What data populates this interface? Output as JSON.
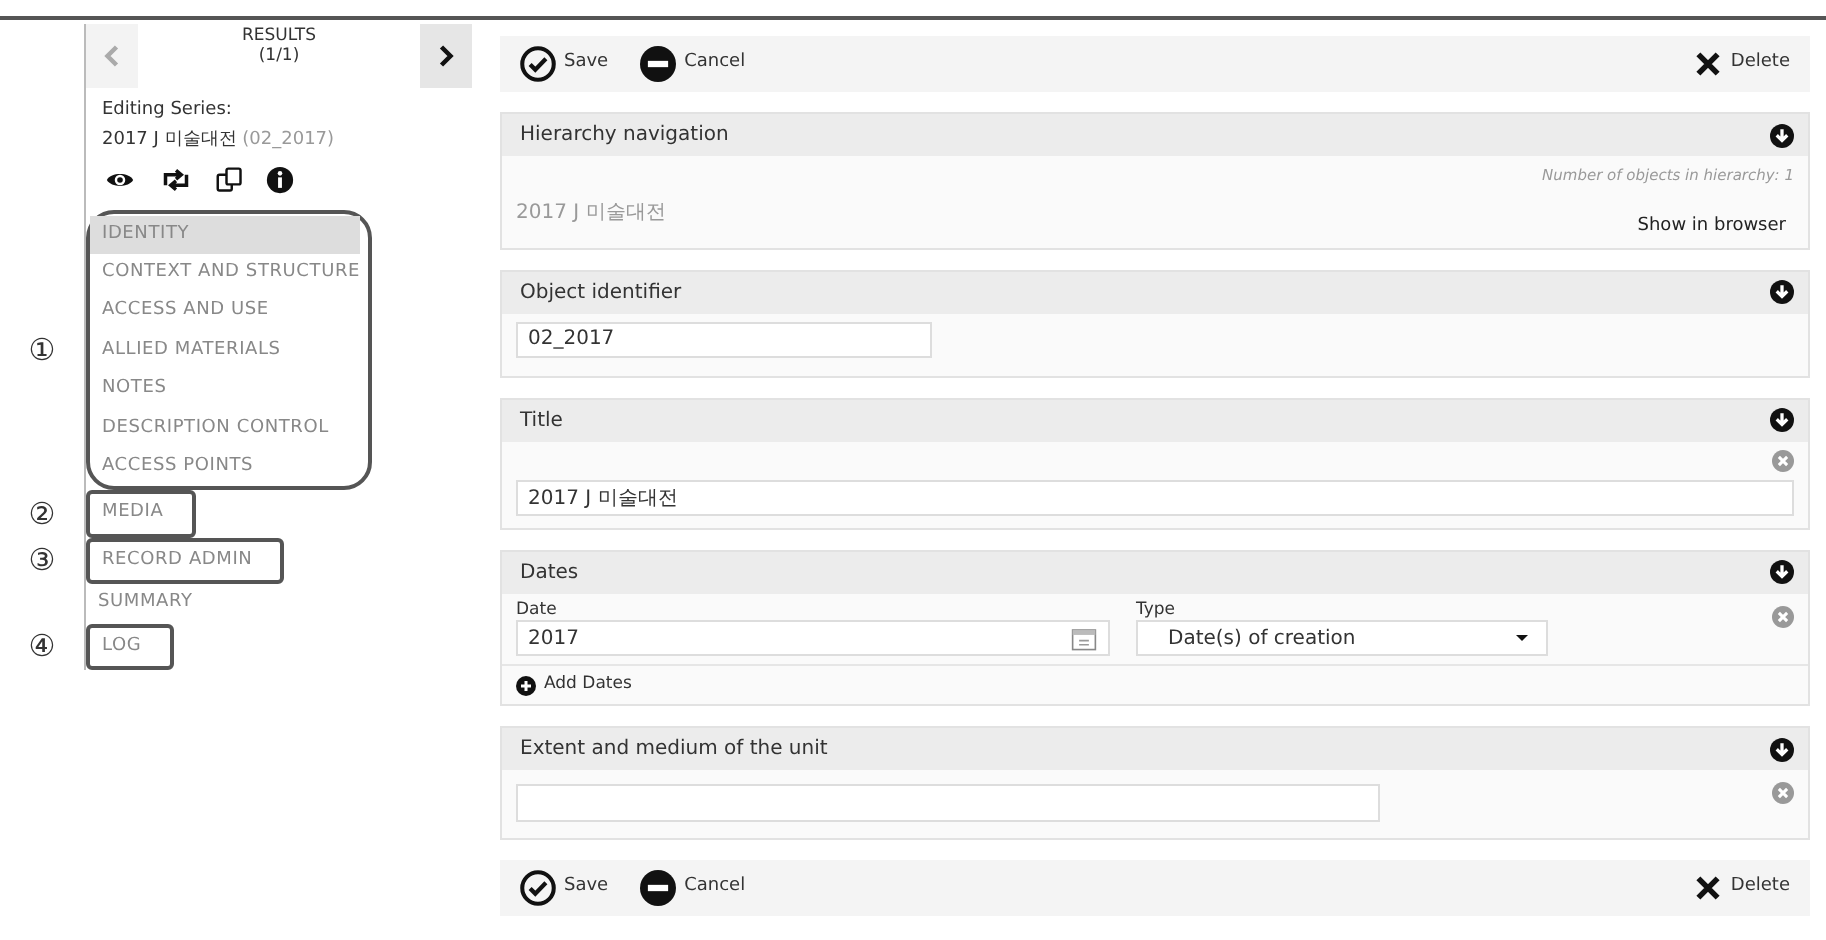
{
  "sidebar": {
    "prev": {
      "disabled": true
    },
    "next": {
      "disabled": false
    },
    "results_title": "RESULTS",
    "results_count": "(1/1)",
    "editing_label": "Editing Series:",
    "record_title": "2017 J 미술대전",
    "record_id": "(02_2017)",
    "nav_groups": [
      {
        "marker": "①",
        "items": [
          {
            "label": "IDENTITY",
            "selected": true
          },
          {
            "label": "CONTEXT AND STRUCTURE",
            "selected": false
          },
          {
            "label": "ACCESS AND USE",
            "selected": false
          },
          {
            "label": "ALLIED MATERIALS",
            "selected": false
          },
          {
            "label": "NOTES",
            "selected": false
          },
          {
            "label": "DESCRIPTION CONTROL",
            "selected": false
          },
          {
            "label": "ACCESS POINTS",
            "selected": false
          }
        ]
      },
      {
        "marker": "②",
        "items": [
          {
            "label": "MEDIA",
            "selected": false
          }
        ]
      },
      {
        "marker": "③",
        "items": [
          {
            "label": "RECORD ADMIN",
            "selected": false
          }
        ]
      },
      {
        "items": [
          {
            "label": "SUMMARY",
            "selected": false
          }
        ]
      },
      {
        "marker": "④",
        "items": [
          {
            "label": "LOG",
            "selected": false
          }
        ]
      }
    ]
  },
  "toolbar_top": {
    "save": "Save",
    "cancel": "Cancel",
    "delete": "Delete"
  },
  "sections": [
    {
      "kind": "hierarchy",
      "title": "Hierarchy navigation",
      "value": "2017 J 미술대전",
      "count_note": "Number of objects in hierarchy: 1",
      "link": "Show in browser"
    },
    {
      "kind": "field",
      "title": "Object identifier",
      "value": "02_2017"
    },
    {
      "kind": "repeatable",
      "title": "Title",
      "value": "2017 J 미술대전"
    },
    {
      "kind": "dates",
      "title": "Dates",
      "date_label": "Date",
      "date_value": "2017",
      "type_label": "Type",
      "type_value": "Date(s) of creation",
      "add_label": "Add Dates"
    },
    {
      "kind": "extent",
      "title": "Extent and medium of the unit"
    }
  ],
  "toolbar_bottom": {
    "save": "Save",
    "cancel": "Cancel",
    "delete": "Delete"
  }
}
